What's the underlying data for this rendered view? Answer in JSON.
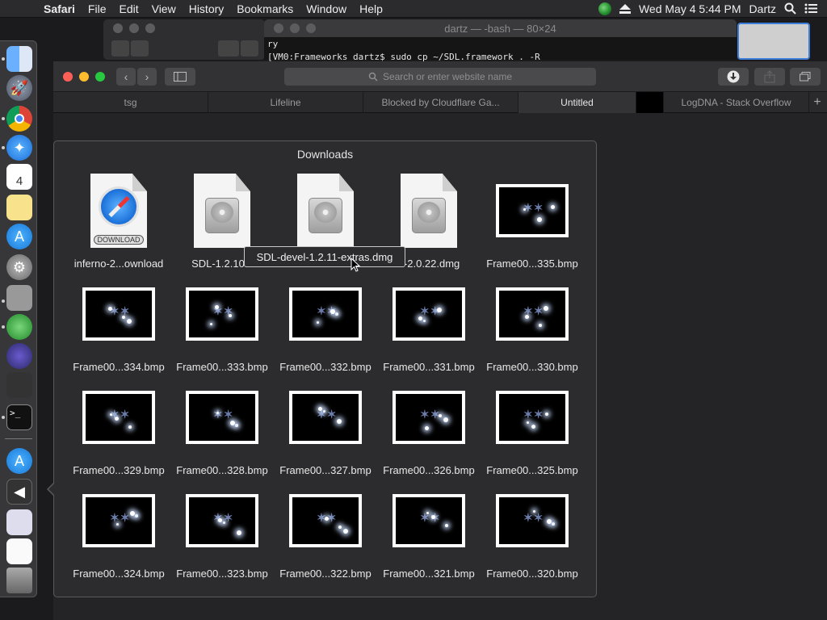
{
  "menubar": {
    "app_name": "Safari",
    "menus": [
      "File",
      "Edit",
      "View",
      "History",
      "Bookmarks",
      "Window",
      "Help"
    ],
    "clock": "Wed May 4  5:44 PM",
    "user": "Dartz"
  },
  "terminal": {
    "title": "dartz — -bash — 80×24",
    "line1": "ry",
    "line2": "[VM0:Frameworks dartz$ sudo cp ~/SDL.framework . -R"
  },
  "safari": {
    "address_placeholder": "Search or enter website name",
    "tabs": [
      "tsg",
      "Lifeline",
      "Blocked by Cloudflare Ga...",
      "Untitled",
      "LogDNA - Stack Overflow"
    ],
    "active_tab": "Untitled"
  },
  "downloads": {
    "title": "Downloads",
    "items": [
      {
        "label": "inferno-2...ownload",
        "kind": "safari-download",
        "badge": "DOWNLOAD"
      },
      {
        "label": "SDL-1.2.10.c",
        "kind": "dmg"
      },
      {
        "label": "",
        "kind": "dmg"
      },
      {
        "label": "2-2.0.22.dmg",
        "kind": "dmg"
      },
      {
        "label": "Frame00...335.bmp",
        "kind": "bmp"
      },
      {
        "label": "Frame00...334.bmp",
        "kind": "bmp"
      },
      {
        "label": "Frame00...333.bmp",
        "kind": "bmp"
      },
      {
        "label": "Frame00...332.bmp",
        "kind": "bmp"
      },
      {
        "label": "Frame00...331.bmp",
        "kind": "bmp"
      },
      {
        "label": "Frame00...330.bmp",
        "kind": "bmp"
      },
      {
        "label": "Frame00...329.bmp",
        "kind": "bmp"
      },
      {
        "label": "Frame00...328.bmp",
        "kind": "bmp"
      },
      {
        "label": "Frame00...327.bmp",
        "kind": "bmp"
      },
      {
        "label": "Frame00...326.bmp",
        "kind": "bmp"
      },
      {
        "label": "Frame00...325.bmp",
        "kind": "bmp"
      },
      {
        "label": "Frame00...324.bmp",
        "kind": "bmp"
      },
      {
        "label": "Frame00...323.bmp",
        "kind": "bmp"
      },
      {
        "label": "Frame00...322.bmp",
        "kind": "bmp"
      },
      {
        "label": "Frame00...321.bmp",
        "kind": "bmp"
      },
      {
        "label": "Frame00...320.bmp",
        "kind": "bmp"
      }
    ],
    "tooltip": "SDL-devel-1.2.11-extras.dmg"
  },
  "dock": {
    "icons": [
      "finder-icon",
      "launchpad-icon",
      "chrome-icon",
      "safari-icon",
      "calendar-icon",
      "notes-icon",
      "app-store-icon",
      "system-preferences-icon",
      "disk-utility-icon",
      "status-app-icon",
      "browser-app-icon",
      "stage-icon",
      "terminal-icon",
      "app-store-icon-2",
      "back-arrow-icon",
      "preview-icon",
      "document-icon",
      "trash-icon"
    ],
    "calendar_day": "4"
  },
  "colors": {
    "close": "#fe5f57",
    "minimize": "#febc2e",
    "zoom": "#28c840",
    "selection": "#3d7fd8"
  }
}
